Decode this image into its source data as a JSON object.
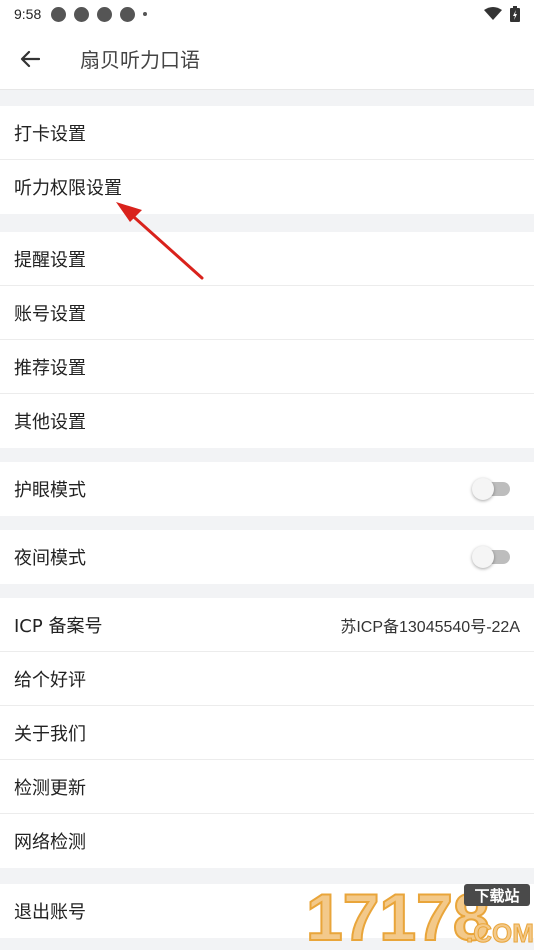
{
  "status_bar": {
    "time": "9:58"
  },
  "app_bar": {
    "title": "扇贝听力口语"
  },
  "groups": [
    {
      "items": [
        {
          "label": "打卡设置"
        },
        {
          "label": "听力权限设置"
        }
      ]
    },
    {
      "items": [
        {
          "label": "提醒设置"
        },
        {
          "label": "账号设置"
        },
        {
          "label": "推荐设置"
        },
        {
          "label": "其他设置"
        }
      ]
    },
    {
      "items": [
        {
          "label": "护眼模式",
          "toggle": "off"
        }
      ]
    },
    {
      "items": [
        {
          "label": "夜间模式",
          "toggle": "off"
        }
      ]
    },
    {
      "items": [
        {
          "label": "ICP 备案号",
          "value": "苏ICP备13045540号-22A"
        },
        {
          "label": "给个好评"
        },
        {
          "label": "关于我们"
        },
        {
          "label": "检测更新"
        },
        {
          "label": "网络检测"
        }
      ]
    },
    {
      "items": [
        {
          "label": "退出账号"
        }
      ]
    }
  ],
  "watermark": {
    "number": "17178",
    "badge": "下载站",
    "domain": ".COM"
  },
  "colors": {
    "annotation_arrow": "#d9221c",
    "watermark_orange": "#e9a53a"
  }
}
